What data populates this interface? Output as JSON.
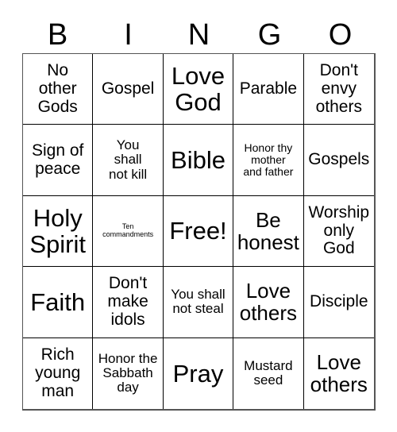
{
  "card": {
    "title": "BINGO",
    "headers": [
      "B",
      "I",
      "N",
      "G",
      "O"
    ],
    "colors": {
      "background": "#ffffff",
      "text": "#000000",
      "grid_line": "#000000",
      "outer_border": "#555555"
    },
    "rows": [
      [
        {
          "text": "No\nother\nGods",
          "size": "md"
        },
        {
          "text": "Gospel",
          "size": "md"
        },
        {
          "text": "Love\nGod",
          "size": "xl"
        },
        {
          "text": "Parable",
          "size": "md"
        },
        {
          "text": "Don't\nenvy\nothers",
          "size": "md"
        }
      ],
      [
        {
          "text": "Sign of\npeace",
          "size": "md"
        },
        {
          "text": "You\nshall\nnot kill",
          "size": "sm"
        },
        {
          "text": "Bible",
          "size": "xl"
        },
        {
          "text": "Honor thy\nmother\nand father",
          "size": "xs"
        },
        {
          "text": "Gospels",
          "size": "md"
        }
      ],
      [
        {
          "text": "Holy\nSpirit",
          "size": "xl"
        },
        {
          "text": "Ten\ncommandments",
          "size": "tiny"
        },
        {
          "text": "Free!",
          "size": "xl"
        },
        {
          "text": "Be\nhonest",
          "size": "lg"
        },
        {
          "text": "Worship\nonly\nGod",
          "size": "md"
        }
      ],
      [
        {
          "text": "Faith",
          "size": "xl"
        },
        {
          "text": "Don't\nmake\nidols",
          "size": "md"
        },
        {
          "text": "You shall\nnot steal",
          "size": "sm"
        },
        {
          "text": "Love\nothers",
          "size": "lg"
        },
        {
          "text": "Disciple",
          "size": "md"
        }
      ],
      [
        {
          "text": "Rich\nyoung\nman",
          "size": "md"
        },
        {
          "text": "Honor the\nSabbath\nday",
          "size": "sm"
        },
        {
          "text": "Pray",
          "size": "xl"
        },
        {
          "text": "Mustard\nseed",
          "size": "sm"
        },
        {
          "text": "Love\nothers",
          "size": "lg"
        }
      ]
    ]
  }
}
